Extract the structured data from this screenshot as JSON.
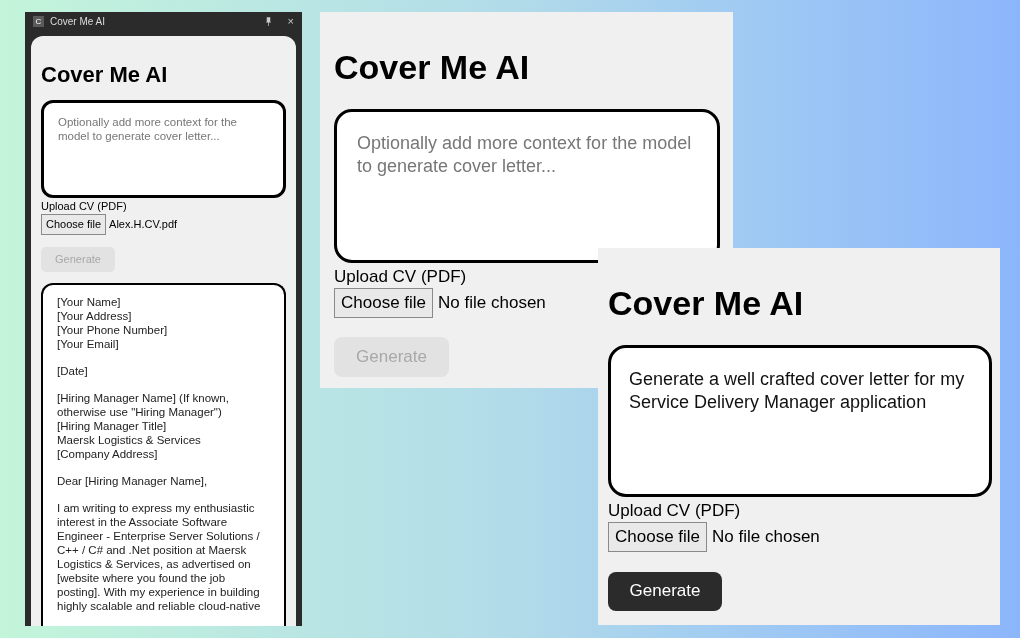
{
  "panels": [
    {
      "kind": "window",
      "title_bar": {
        "logo": "C",
        "title": "Cover Me AI",
        "close": "×"
      },
      "heading": "Cover Me AI",
      "context": {
        "placeholder": "Optionally add more context for the model to generate cover letter..."
      },
      "upload_label": "Upload CV (PDF)",
      "choose_button": "Choose file",
      "file_name": "Alex.H.CV.pdf",
      "generate": {
        "label": "Generate",
        "disabled": true
      },
      "letter": [
        "[Your Name]\n[Your Address]\n[Your Phone Number]\n[Your Email]",
        "[Date]",
        "[Hiring Manager Name] (If known, otherwise use \"Hiring Manager\")\n[Hiring Manager Title]\nMaersk Logistics & Services\n[Company Address]",
        "Dear [Hiring Manager Name],",
        "I am writing to express my enthusiastic interest in the Associate Software Engineer - Enterprise Server Solutions / C++ / C# and .Net position at Maersk Logistics & Services, as advertised on [website where you found the job posting]. With my experience in building highly scalable and reliable cloud-native"
      ]
    },
    {
      "kind": "panel",
      "heading": "Cover Me AI",
      "context": {
        "placeholder": "Optionally add more context for the model to generate cover letter..."
      },
      "upload_label": "Upload CV (PDF)",
      "choose_button": "Choose file",
      "file_name": "No file chosen",
      "generate": {
        "label": "Generate",
        "disabled": true
      }
    },
    {
      "kind": "panel",
      "heading": "Cover Me AI",
      "context": {
        "value": "Generate a well crafted cover letter for my Service Delivery Manager application"
      },
      "upload_label": "Upload CV (PDF)",
      "choose_button": "Choose file",
      "file_name": "No file chosen",
      "generate": {
        "label": "Generate",
        "disabled": false
      }
    }
  ]
}
